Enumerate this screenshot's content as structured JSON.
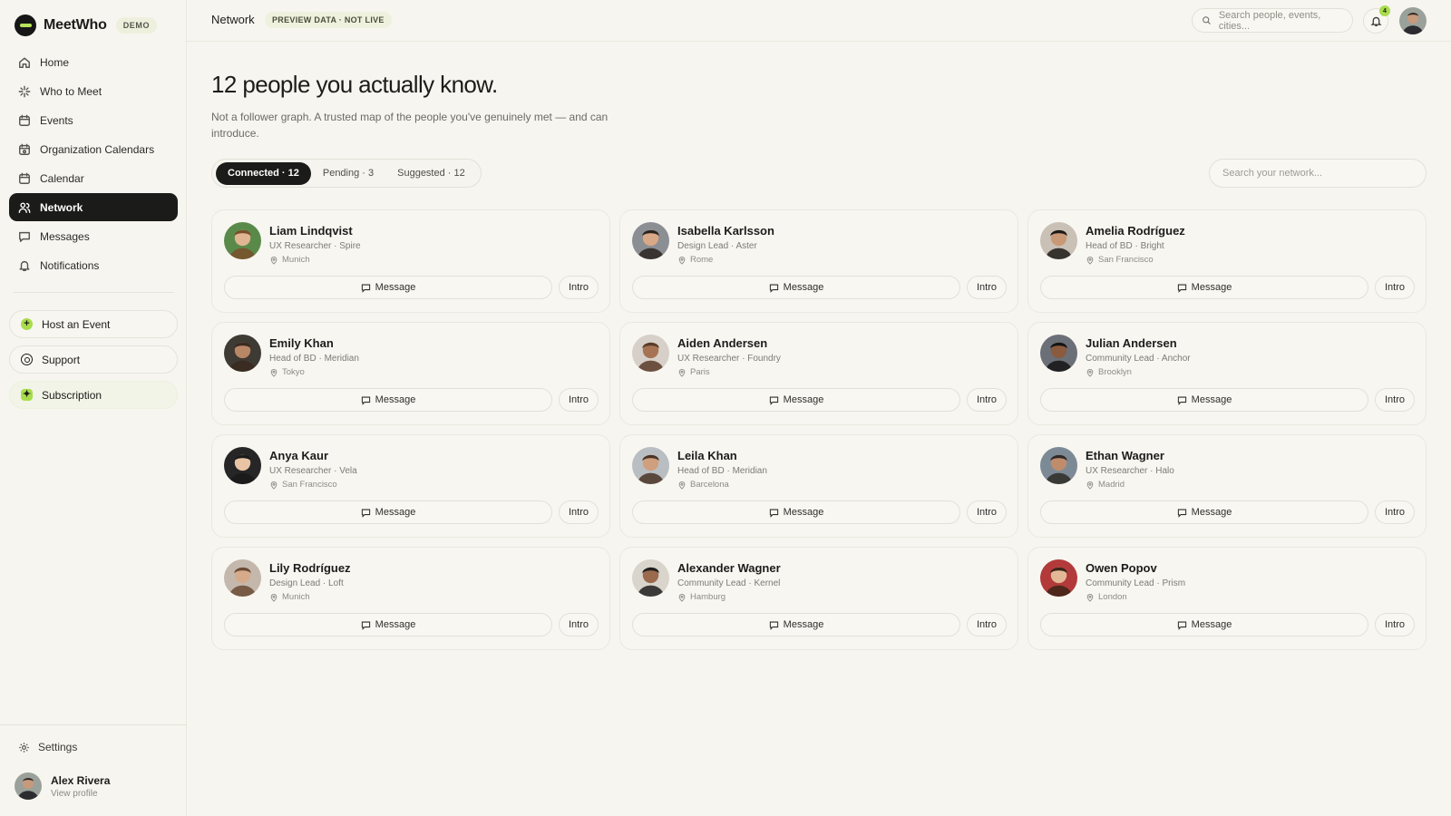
{
  "brand": {
    "name": "MeetWho",
    "badge": "DEMO"
  },
  "sidebar": {
    "items": [
      {
        "label": "Home",
        "icon": "home-icon"
      },
      {
        "label": "Who to Meet",
        "icon": "sparkle-icon"
      },
      {
        "label": "Events",
        "icon": "calendar-icon"
      },
      {
        "label": "Organization Calendars",
        "icon": "calendar-org-icon"
      },
      {
        "label": "Calendar",
        "icon": "calendar-icon"
      },
      {
        "label": "Network",
        "icon": "users-icon",
        "active": true
      },
      {
        "label": "Messages",
        "icon": "message-icon"
      },
      {
        "label": "Notifications",
        "icon": "bell-icon"
      }
    ],
    "host_event": "Host an Event",
    "support": "Support",
    "subscription": "Subscription",
    "settings": "Settings",
    "profile": {
      "name": "Alex Rivera",
      "link": "View profile"
    }
  },
  "topbar": {
    "crumb": "Network",
    "badge": "PREVIEW DATA · NOT LIVE",
    "search_placeholder": "Search people, events, cities...",
    "notification_count": "4"
  },
  "main": {
    "title": "12 people you actually know.",
    "subtitle": "Not a follower graph. A trusted map of the people you've genuinely met — and can introduce.",
    "tabs": [
      {
        "label": "Connected · 12",
        "active": true
      },
      {
        "label": "Pending · 3"
      },
      {
        "label": "Suggested · 12"
      }
    ],
    "search_placeholder": "Search your network..."
  },
  "labels": {
    "message": "Message",
    "intro": "Intro"
  },
  "people": [
    {
      "name": "Liam Lindqvist",
      "role": "UX Researcher · Spire",
      "city": "Munich"
    },
    {
      "name": "Isabella Karlsson",
      "role": "Design Lead · Aster",
      "city": "Rome"
    },
    {
      "name": "Amelia Rodríguez",
      "role": "Head of BD · Bright",
      "city": "San Francisco"
    },
    {
      "name": "Emily Khan",
      "role": "Head of BD · Meridian",
      "city": "Tokyo"
    },
    {
      "name": "Aiden Andersen",
      "role": "UX Researcher · Foundry",
      "city": "Paris"
    },
    {
      "name": "Julian Andersen",
      "role": "Community Lead · Anchor",
      "city": "Brooklyn"
    },
    {
      "name": "Anya Kaur",
      "role": "UX Researcher · Vela",
      "city": "San Francisco"
    },
    {
      "name": "Leila Khan",
      "role": "Head of BD · Meridian",
      "city": "Barcelona"
    },
    {
      "name": "Ethan Wagner",
      "role": "UX Researcher · Halo",
      "city": "Madrid"
    },
    {
      "name": "Lily Rodríguez",
      "role": "Design Lead · Loft",
      "city": "Munich"
    },
    {
      "name": "Alexander Wagner",
      "role": "Community Lead · Kernel",
      "city": "Hamburg"
    },
    {
      "name": "Owen Popov",
      "role": "Community Lead · Prism",
      "city": "London"
    }
  ],
  "colors": {
    "accent": "#a8dc4c",
    "dark": "#1b1b1a",
    "background": "#f7f5ef"
  }
}
